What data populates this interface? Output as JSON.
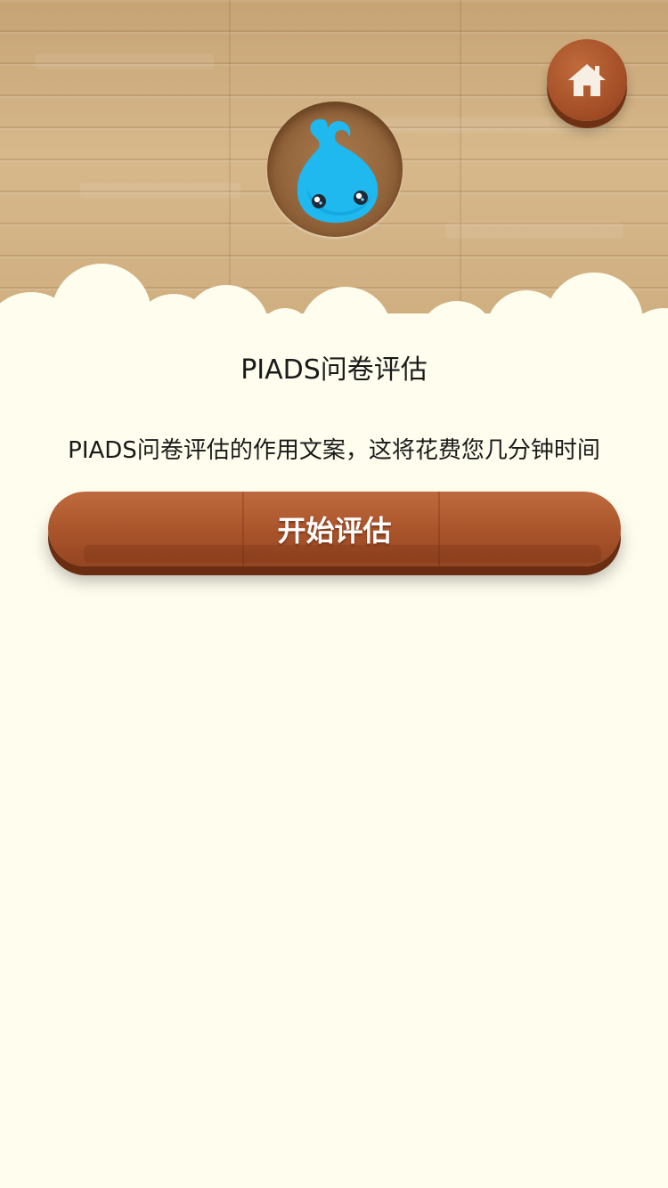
{
  "header": {
    "home_icon": "home-icon",
    "avatar_icon": "water-drop-mascot"
  },
  "content": {
    "title": "PIADS问卷评估",
    "description": "PIADS问卷评估的作用文案，这将花费您几分钟时间"
  },
  "actions": {
    "start_label": "开始评估"
  },
  "colors": {
    "background": "#fefdee",
    "wood_light": "#d6b88b",
    "button_wood": "#a9532a",
    "mascot_blue": "#1fb8ef"
  }
}
